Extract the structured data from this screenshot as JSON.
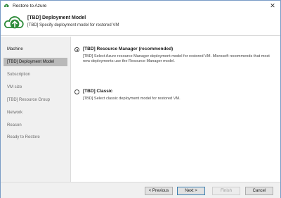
{
  "window": {
    "title": "Restore to Azure"
  },
  "header": {
    "title": "[TBD] Deployment Model",
    "subtitle": "[TBD] Specify deployment model for restored VM"
  },
  "sidebar": {
    "items": [
      {
        "label": "Machine",
        "state": "done"
      },
      {
        "label": "[TBD] Deployment Model",
        "state": "active"
      },
      {
        "label": "Subscription",
        "state": "pending"
      },
      {
        "label": "VM size",
        "state": "pending"
      },
      {
        "label": "[TBD] Resource Group",
        "state": "pending"
      },
      {
        "label": "Network",
        "state": "pending"
      },
      {
        "label": "Reason",
        "state": "pending"
      },
      {
        "label": "Ready to Restore",
        "state": "pending"
      }
    ]
  },
  "options": [
    {
      "label": "[TBD] Resource Manager (recommended)",
      "description": "[TBD] Select Azure resource Manager deployment model for restored VM. Microsoft recommends that most new deployments use the Resource Manager model.",
      "selected": true
    },
    {
      "label": "[TBD] Classic",
      "description": "[TBD] Select classic deployment model for restored VM.",
      "selected": false
    }
  ],
  "footer": {
    "previous": "< Previous",
    "next": "Next >",
    "finish": "Finish",
    "cancel": "Cancel"
  },
  "colors": {
    "accent": "#2e8b3a",
    "active_nav": "#b9b9b9",
    "window_border": "#7a9cc6"
  }
}
